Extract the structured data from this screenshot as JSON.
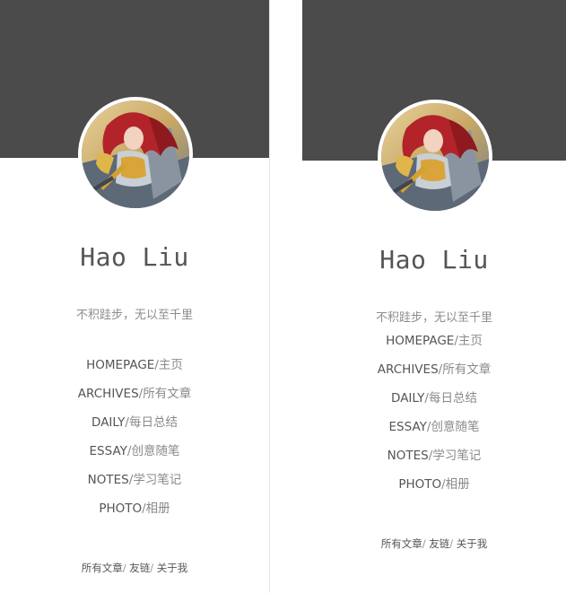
{
  "panels": [
    {
      "name": "Hao Liu",
      "motto": "不积跬步，无以至千里",
      "nav": [
        {
          "en": "HOMEPAGE",
          "cn": "主页"
        },
        {
          "en": "ARCHIVES",
          "cn": "所有文章"
        },
        {
          "en": "DAILY",
          "cn": "每日总结"
        },
        {
          "en": "ESSAY",
          "cn": "创意随笔"
        },
        {
          "en": "NOTES",
          "cn": "学习笔记"
        },
        {
          "en": "PHOTO",
          "cn": "相册"
        }
      ],
      "footer": [
        "所有文章",
        "友链",
        "关于我"
      ]
    },
    {
      "name": "Hao Liu",
      "motto": "不积跬步，无以至千里",
      "nav": [
        {
          "en": "HOMEPAGE",
          "cn": "主页"
        },
        {
          "en": "ARCHIVES",
          "cn": "所有文章"
        },
        {
          "en": "DAILY",
          "cn": "每日总结"
        },
        {
          "en": "ESSAY",
          "cn": "创意随笔"
        },
        {
          "en": "NOTES",
          "cn": "学习笔记"
        },
        {
          "en": "PHOTO",
          "cn": "相册"
        }
      ],
      "footer": [
        "所有文章",
        "友链",
        "关于我"
      ]
    }
  ],
  "separator": "/",
  "colors": {
    "cover": "#4b4b4b",
    "background": "#ffffff",
    "text": "#555555",
    "muted": "#8c8c8c"
  },
  "icons": {
    "avatar": "anime-warrior-avatar"
  }
}
